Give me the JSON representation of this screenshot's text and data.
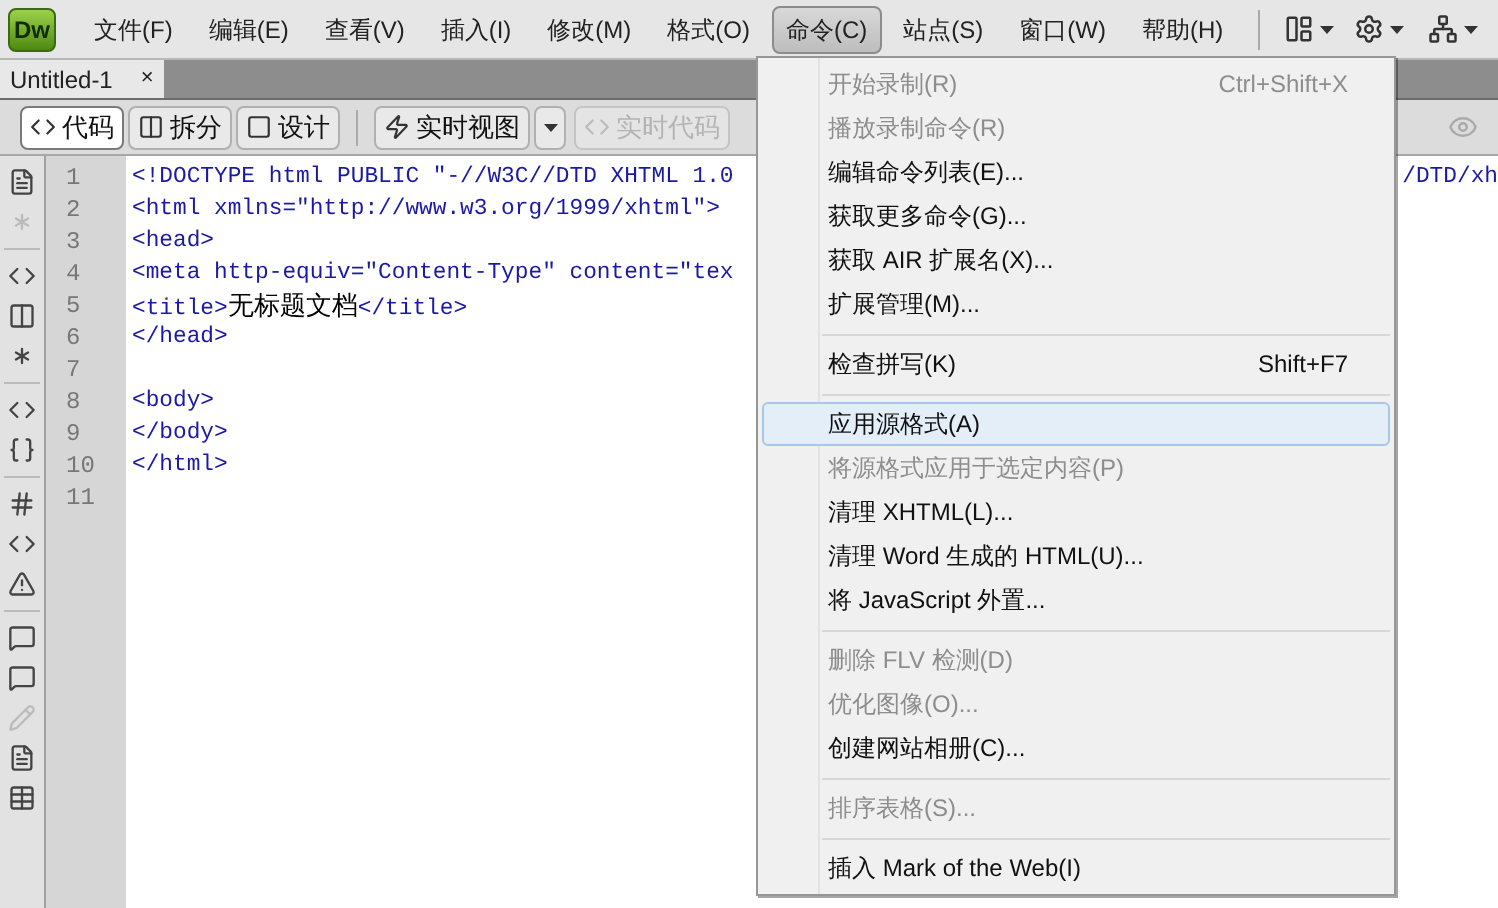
{
  "app": {
    "logo": "Dw"
  },
  "menubar": [
    {
      "label": "文件(F)",
      "selected": false
    },
    {
      "label": "编辑(E)",
      "selected": false
    },
    {
      "label": "查看(V)",
      "selected": false
    },
    {
      "label": "插入(I)",
      "selected": false
    },
    {
      "label": "修改(M)",
      "selected": false
    },
    {
      "label": "格式(O)",
      "selected": false
    },
    {
      "label": "命令(C)",
      "selected": true
    },
    {
      "label": "站点(S)",
      "selected": false
    },
    {
      "label": "窗口(W)",
      "selected": false
    },
    {
      "label": "帮助(H)",
      "selected": false
    }
  ],
  "document_tabs": [
    {
      "label": "Untitled-1",
      "close": "×",
      "selected": true
    }
  ],
  "view_toolbar": {
    "views": [
      {
        "label": "代码",
        "selected": true
      },
      {
        "label": "拆分",
        "selected": false
      },
      {
        "label": "设计",
        "selected": false
      }
    ],
    "live_view": {
      "label": "实时视图"
    },
    "live_code": {
      "label": "实时代码",
      "disabled": true
    }
  },
  "code_editor": {
    "lines": [
      {
        "number": "1",
        "parts": [
          {
            "text": "<!DOCTYPE html PUBLIC \"-//W3C//DTD XHTML 1.0",
            "kind": "tag"
          }
        ],
        "tail": "/DTD/xh"
      },
      {
        "number": "2",
        "parts": [
          {
            "text": "<html xmlns=\"http://www.w3.org/1999/xhtml\">",
            "kind": "tag"
          }
        ]
      },
      {
        "number": "3",
        "parts": [
          {
            "text": "<head>",
            "kind": "tag"
          }
        ]
      },
      {
        "number": "4",
        "parts": [
          {
            "text": "<meta http-equiv=\"Content-Type\" content=\"tex",
            "kind": "tag"
          }
        ]
      },
      {
        "number": "5",
        "parts": [
          {
            "text": "<title>",
            "kind": "tag"
          },
          {
            "text": "无标题文档",
            "kind": "content"
          },
          {
            "text": "</title>",
            "kind": "tag"
          }
        ]
      },
      {
        "number": "6",
        "parts": [
          {
            "text": "</head>",
            "kind": "tag"
          }
        ]
      },
      {
        "number": "7"
      },
      {
        "number": "8",
        "parts": [
          {
            "text": "<body>",
            "kind": "tag"
          }
        ]
      },
      {
        "number": "9",
        "parts": [
          {
            "text": "</body>",
            "kind": "tag"
          }
        ]
      },
      {
        "number": "10",
        "parts": [
          {
            "text": "</html>",
            "kind": "tag"
          }
        ]
      },
      {
        "number": "11"
      }
    ]
  },
  "command_menu": {
    "items": [
      {
        "kind": "item",
        "label": "开始录制(R)",
        "shortcut": "Ctrl+Shift+X",
        "disabled": true,
        "selected": false
      },
      {
        "kind": "item",
        "label": "播放录制命令(R)",
        "disabled": true,
        "selected": false
      },
      {
        "kind": "item",
        "label": "编辑命令列表(E)...",
        "disabled": false,
        "selected": false
      },
      {
        "kind": "item",
        "label": "获取更多命令(G)...",
        "disabled": false,
        "selected": false
      },
      {
        "kind": "item",
        "label": "获取 AIR 扩展名(X)...",
        "disabled": false,
        "selected": false
      },
      {
        "kind": "item",
        "label": "扩展管理(M)...",
        "disabled": false,
        "selected": false
      },
      {
        "kind": "separator"
      },
      {
        "kind": "item",
        "label": "检查拼写(K)",
        "shortcut": "Shift+F7",
        "disabled": false,
        "selected": false
      },
      {
        "kind": "separator"
      },
      {
        "kind": "item",
        "label": "应用源格式(A)",
        "disabled": false,
        "selected": true
      },
      {
        "kind": "item",
        "label": "将源格式应用于选定内容(P)",
        "disabled": true,
        "selected": false
      },
      {
        "kind": "item",
        "label": "清理 XHTML(L)...",
        "disabled": false,
        "selected": false
      },
      {
        "kind": "item",
        "label": "清理 Word 生成的 HTML(U)...",
        "disabled": false,
        "selected": false
      },
      {
        "kind": "item",
        "label": "将 JavaScript 外置...",
        "disabled": false,
        "selected": false
      },
      {
        "kind": "separator"
      },
      {
        "kind": "item",
        "label": "删除 FLV 检测(D)",
        "disabled": true,
        "selected": false
      },
      {
        "kind": "item",
        "label": "优化图像(O)...",
        "disabled": true,
        "selected": false
      },
      {
        "kind": "item",
        "label": "创建网站相册(C)...",
        "disabled": false,
        "selected": false
      },
      {
        "kind": "separator"
      },
      {
        "kind": "item",
        "label": "排序表格(S)...",
        "disabled": true,
        "selected": false
      },
      {
        "kind": "separator"
      },
      {
        "kind": "item",
        "label": "插入 Mark of the Web(I)",
        "disabled": false,
        "selected": false
      }
    ]
  }
}
